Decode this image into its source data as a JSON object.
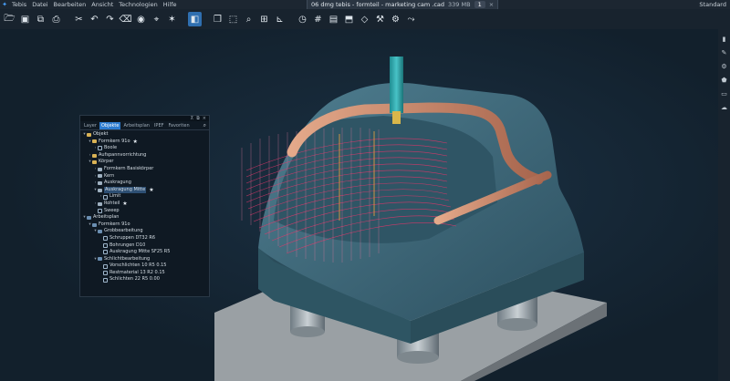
{
  "menubar": {
    "items": [
      "Tebis",
      "Datei",
      "Bearbeiten",
      "Ansicht",
      "Technologien",
      "Hilfe"
    ],
    "document_tab": "06 dmg tebis - formteil - marketing cam .cad",
    "memory": "339 MB",
    "tab_counter": "1",
    "close_glyph": "×",
    "layout_label": "Standard"
  },
  "toolbar": {
    "icons": [
      "open-folder-icon",
      "save-icon",
      "save-all-icon",
      "print-icon",
      "cut-icon",
      "undo-icon",
      "redo-icon",
      "delete-icon",
      "visibility-icon",
      "pick-icon",
      "display-mode-icon",
      "view-cube-icon",
      "layers-icon",
      "zoom-icon",
      "zoom-all-icon",
      "axes-icon",
      "clock-icon",
      "grid-icon",
      "frame-icon",
      "arrange-icon",
      "measure-icon",
      "analysis-icon",
      "tool-icon",
      "nc-icon"
    ]
  },
  "panel": {
    "tabs": [
      "Layer",
      "Objekte",
      "Arbeitsplan",
      "IPEF",
      "Favoriten"
    ],
    "active_tab": "Objekte",
    "tree": [
      {
        "label": "Objekt",
        "indent": 0,
        "icon": "folder",
        "twisty": "v"
      },
      {
        "label": "Formkern 91o",
        "indent": 1,
        "icon": "folder",
        "twisty": "v",
        "star": true
      },
      {
        "label": "Boole",
        "indent": 2,
        "icon": "op",
        "twisty": ">"
      },
      {
        "label": "Aufspannvorrichtung",
        "indent": 1,
        "icon": "folder",
        "twisty": ">"
      },
      {
        "label": "Körper",
        "indent": 1,
        "icon": "folder",
        "twisty": "v"
      },
      {
        "label": "Formkern Basiskörper",
        "indent": 2,
        "icon": "body",
        "twisty": ">"
      },
      {
        "label": "Kern",
        "indent": 2,
        "icon": "body",
        "twisty": ">"
      },
      {
        "label": "Auskragung",
        "indent": 2,
        "icon": "body",
        "twisty": ">"
      },
      {
        "label": "Auskragung Mitte",
        "indent": 2,
        "icon": "body",
        "twisty": "v",
        "star": true,
        "selected": true
      },
      {
        "label": "Limit",
        "indent": 3,
        "icon": "op",
        "twisty": ">"
      },
      {
        "label": "Rohteil",
        "indent": 2,
        "icon": "body",
        "twisty": ">",
        "star": true
      },
      {
        "label": "Sweep",
        "indent": 2,
        "icon": "op",
        "twisty": ""
      },
      {
        "label": "Arbeitsplan",
        "indent": 0,
        "icon": "plan",
        "twisty": "v"
      },
      {
        "label": "Formkern 91o",
        "indent": 1,
        "icon": "plan",
        "twisty": "v"
      },
      {
        "label": "Grobbearbeitung",
        "indent": 2,
        "icon": "plan",
        "twisty": "v"
      },
      {
        "label": "Schruppen DT32 R6",
        "indent": 3,
        "icon": "op",
        "twisty": ""
      },
      {
        "label": "Bohrungen D10",
        "indent": 3,
        "icon": "op",
        "twisty": ""
      },
      {
        "label": "Auskragung Mitte SF25 R5",
        "indent": 3,
        "icon": "op",
        "twisty": ""
      },
      {
        "label": "Schlichtbearbeitung",
        "indent": 2,
        "icon": "plan",
        "twisty": "v"
      },
      {
        "label": "Vorschlichten 10 R5 0.15",
        "indent": 3,
        "icon": "op",
        "twisty": ""
      },
      {
        "label": "Restmaterial 13 R2 0.15",
        "indent": 3,
        "icon": "op",
        "twisty": ""
      },
      {
        "label": "Schlichten 22 R5 0.00",
        "indent": 3,
        "icon": "op",
        "twisty": ""
      }
    ]
  },
  "colors": {
    "accent": "#2c7bd0",
    "part": "#3e6676",
    "copper": "#c8896b",
    "toolpath": "#e8356a",
    "spindle": "#2aa3a8"
  }
}
